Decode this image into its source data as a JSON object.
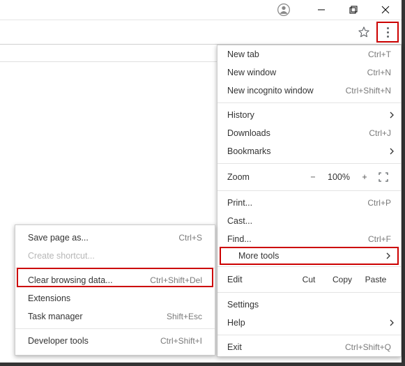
{
  "titlebar": {
    "avatar_icon": "user-circle",
    "minimize": "minimize",
    "maximize": "maximize",
    "close": "close"
  },
  "toolbar": {
    "star_icon": "star",
    "menu_icon": "more-vertical"
  },
  "menu": {
    "new_tab": {
      "label": "New tab",
      "shortcut": "Ctrl+T"
    },
    "new_window": {
      "label": "New window",
      "shortcut": "Ctrl+N"
    },
    "new_incognito": {
      "label": "New incognito window",
      "shortcut": "Ctrl+Shift+N"
    },
    "history": {
      "label": "History"
    },
    "downloads": {
      "label": "Downloads",
      "shortcut": "Ctrl+J"
    },
    "bookmarks": {
      "label": "Bookmarks"
    },
    "zoom": {
      "label": "Zoom",
      "minus": "−",
      "pct": "100%",
      "plus": "+"
    },
    "print": {
      "label": "Print...",
      "shortcut": "Ctrl+P"
    },
    "cast": {
      "label": "Cast..."
    },
    "find": {
      "label": "Find...",
      "shortcut": "Ctrl+F"
    },
    "more_tools": {
      "label": "More tools"
    },
    "edit": {
      "label": "Edit",
      "cut": "Cut",
      "copy": "Copy",
      "paste": "Paste"
    },
    "settings": {
      "label": "Settings"
    },
    "help": {
      "label": "Help"
    },
    "exit": {
      "label": "Exit",
      "shortcut": "Ctrl+Shift+Q"
    }
  },
  "submenu": {
    "save_page": {
      "label": "Save page as...",
      "shortcut": "Ctrl+S"
    },
    "create_shortcut": {
      "label": "Create shortcut..."
    },
    "clear_data": {
      "label": "Clear browsing data...",
      "shortcut": "Ctrl+Shift+Del"
    },
    "extensions": {
      "label": "Extensions"
    },
    "task_manager": {
      "label": "Task manager",
      "shortcut": "Shift+Esc"
    },
    "dev_tools": {
      "label": "Developer tools",
      "shortcut": "Ctrl+Shift+I"
    }
  }
}
